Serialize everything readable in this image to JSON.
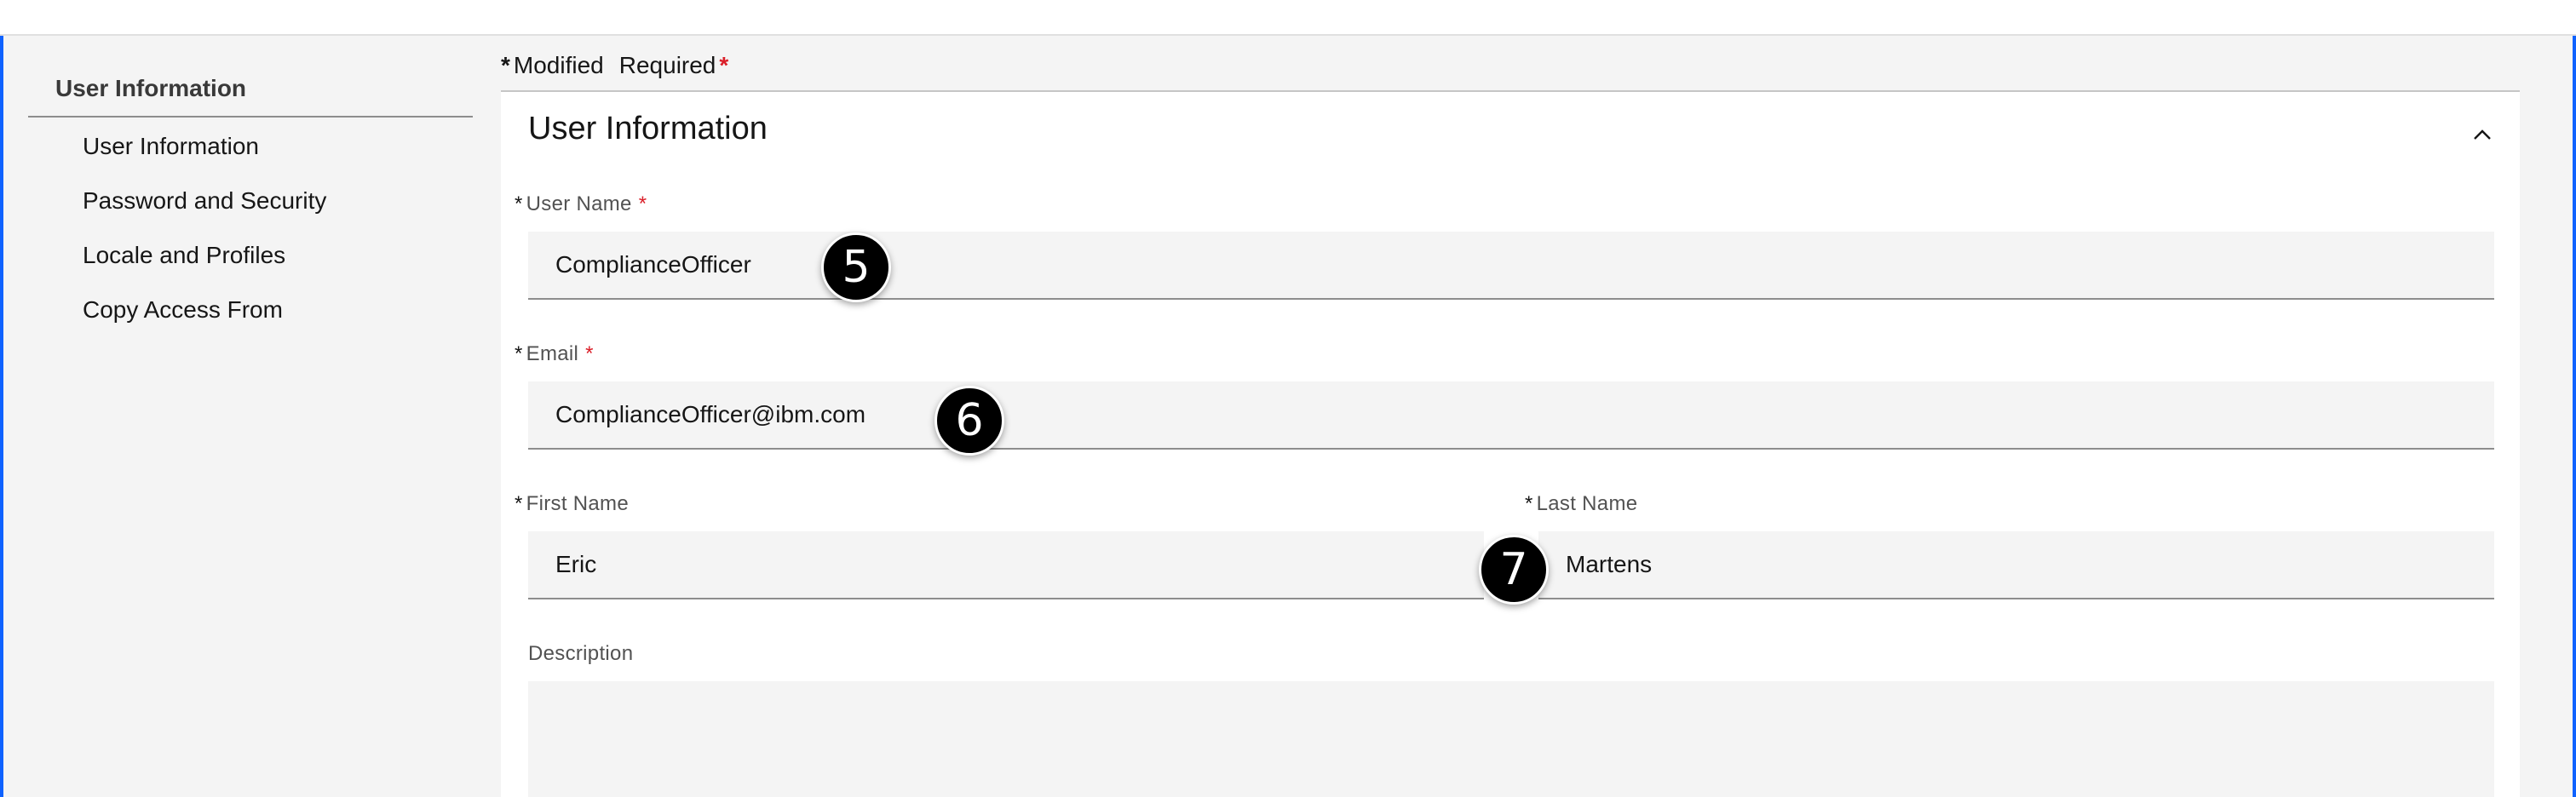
{
  "sidebar": {
    "heading": "User Information",
    "items": [
      {
        "label": "User Information"
      },
      {
        "label": "Password and Security"
      },
      {
        "label": "Locale and Profiles"
      },
      {
        "label": "Copy Access From"
      }
    ]
  },
  "legend": {
    "modified_marker": "*",
    "modified_label": "Modified",
    "required_label": "Required",
    "required_marker": "*"
  },
  "section": {
    "title": "User Information",
    "collapse_icon": "chevron-up-icon"
  },
  "fields": {
    "user_name": {
      "modified_marker": "*",
      "label": "User Name",
      "required_marker": "*",
      "value": "ComplianceOfficer"
    },
    "email": {
      "modified_marker": "*",
      "label": "Email",
      "required_marker": "*",
      "value": "ComplianceOfficer@ibm.com"
    },
    "first_name": {
      "modified_marker": "*",
      "label": "First Name",
      "value": "Eric"
    },
    "last_name": {
      "modified_marker": "*",
      "label": "Last Name",
      "value": "Martens"
    },
    "description": {
      "label": "Description",
      "value": ""
    }
  },
  "annotations": [
    {
      "label": "5"
    },
    {
      "label": "6"
    },
    {
      "label": "7"
    }
  ],
  "colors": {
    "accent": "#0f62fe",
    "required": "#da1e28",
    "field_bg": "#f4f4f4",
    "badge": "#000000"
  }
}
